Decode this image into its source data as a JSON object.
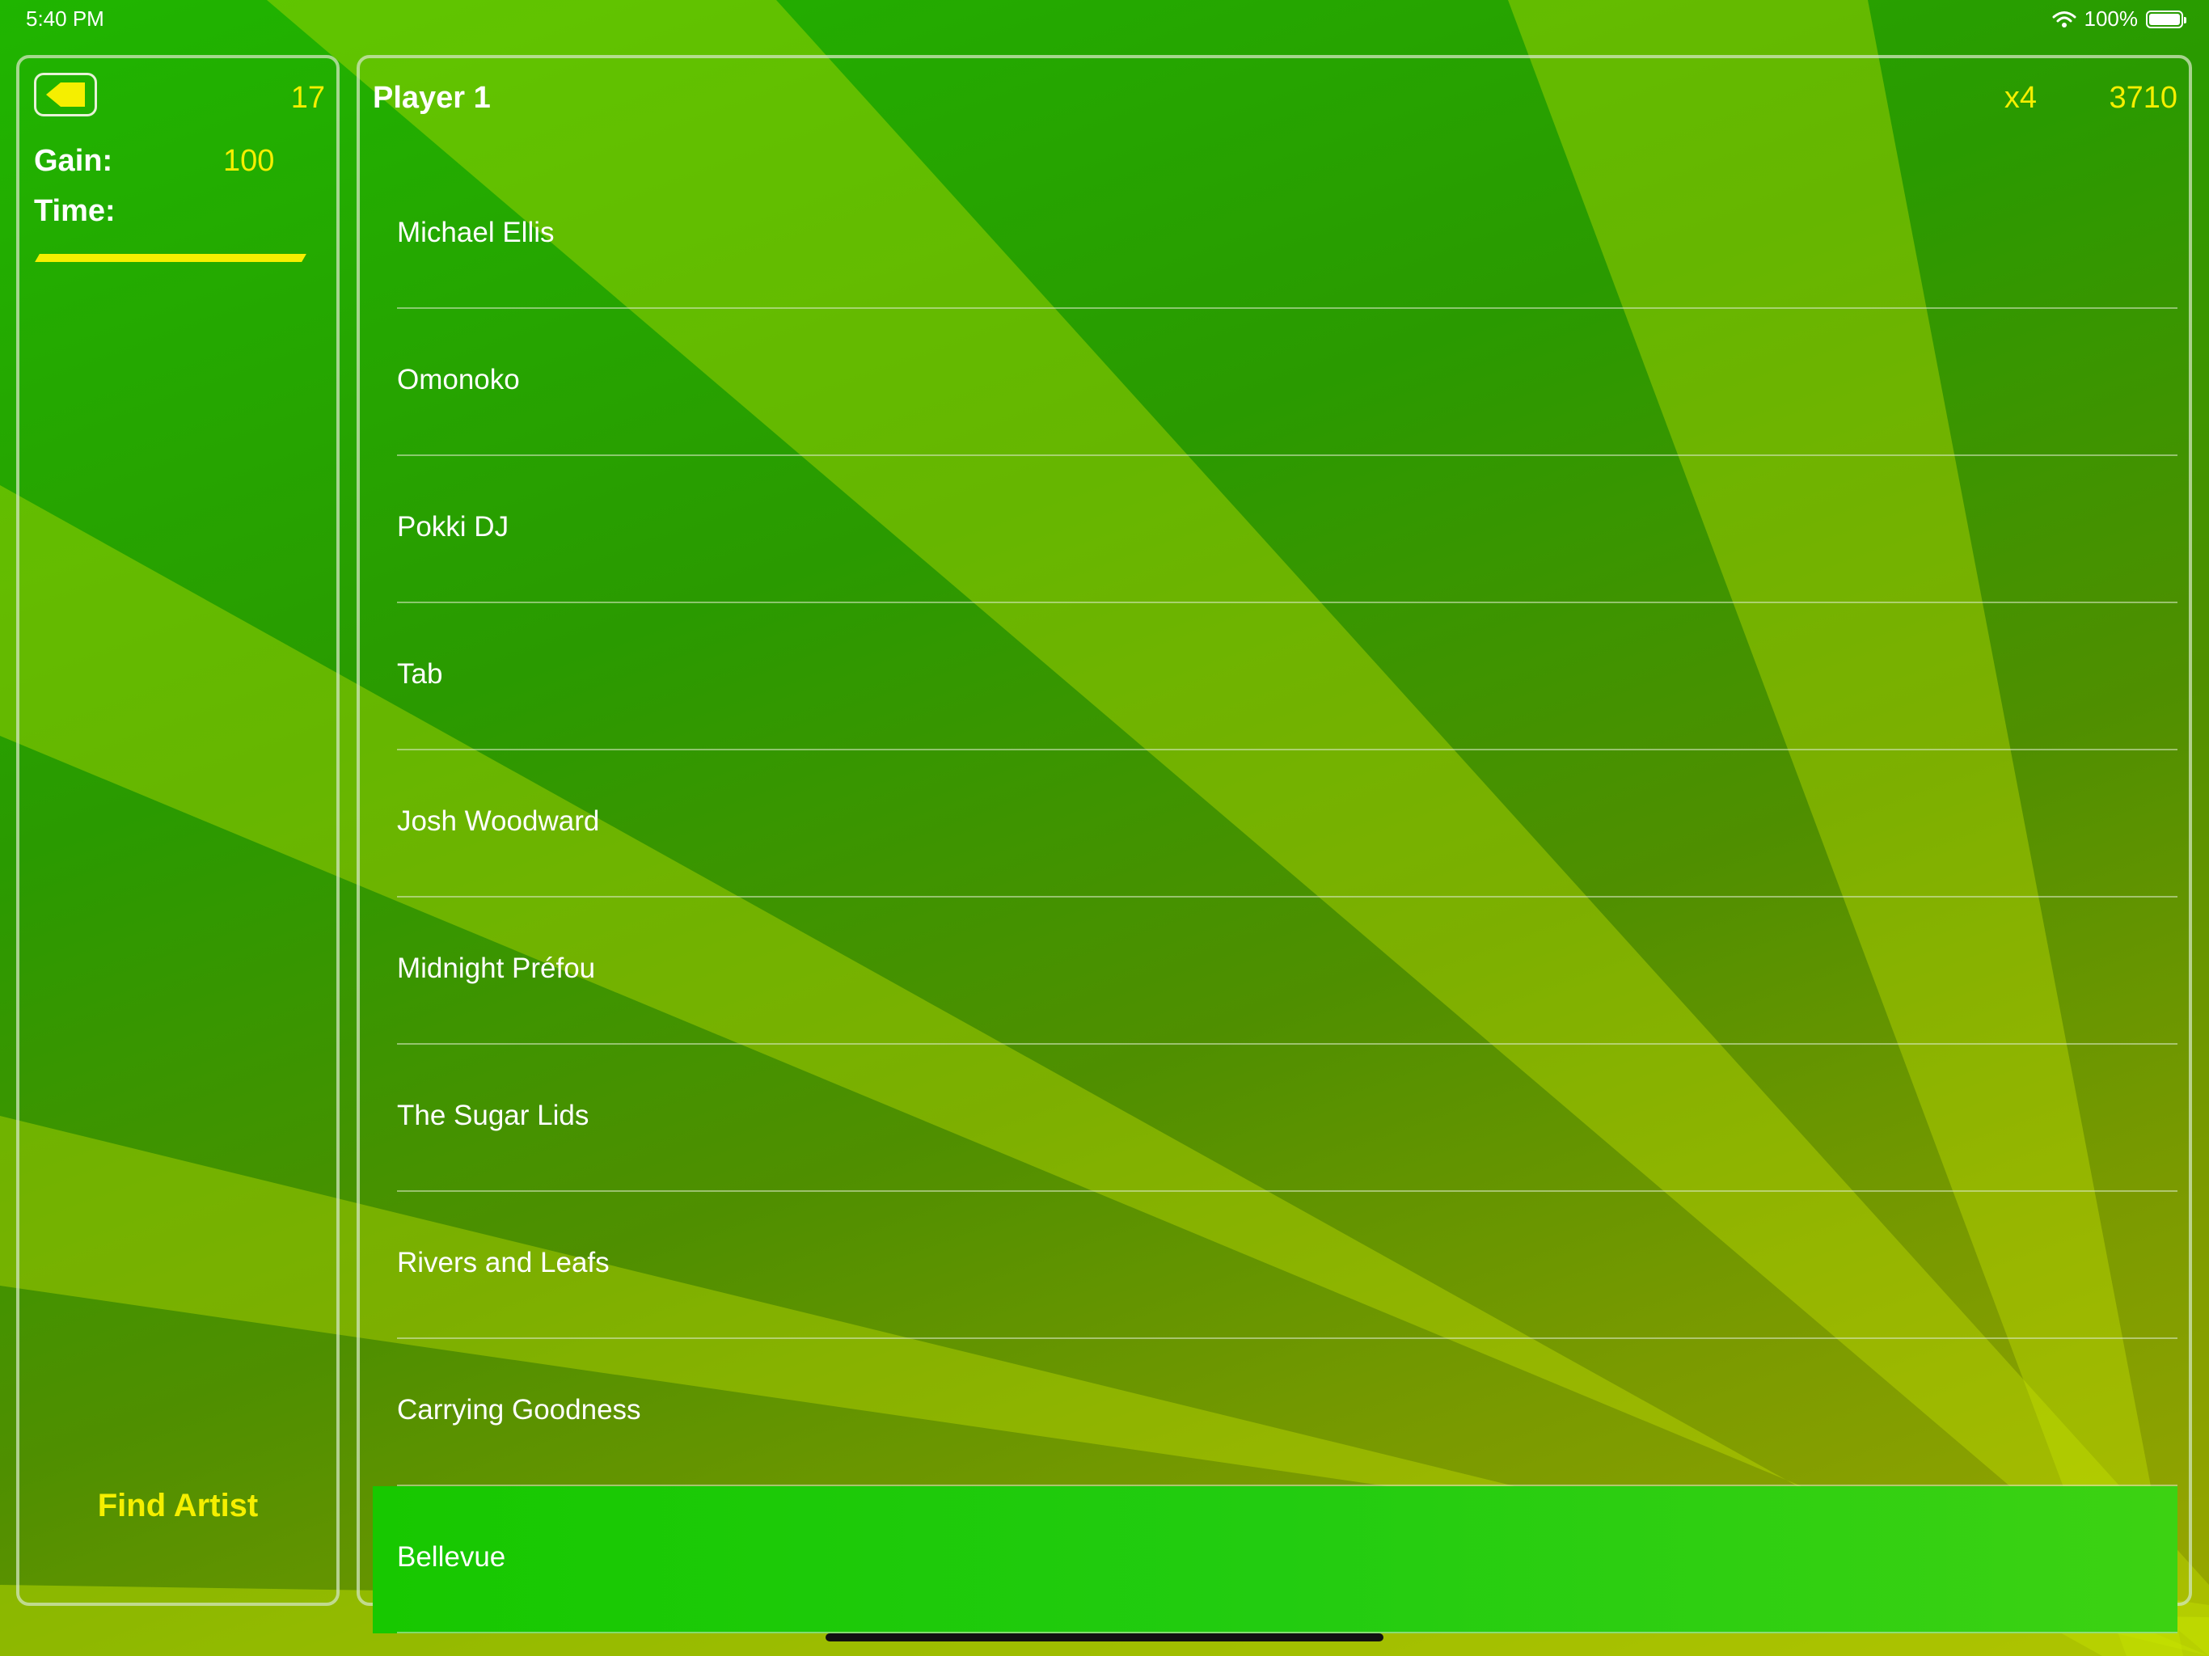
{
  "status_bar": {
    "time": "5:40 PM",
    "battery_percent": "100%"
  },
  "sidebar": {
    "back_icon": "back-arrow-icon",
    "level_count": "17",
    "gain_label": "Gain:",
    "gain_value": "100",
    "time_label": "Time:",
    "time_remaining_fraction": 1.0,
    "find_button_label": "Find Artist"
  },
  "main": {
    "player_name": "Player 1",
    "multiplier": "x4",
    "score": "3710",
    "artists": [
      {
        "name": "Michael Ellis"
      },
      {
        "name": "Omonoko"
      },
      {
        "name": "Pokki DJ"
      },
      {
        "name": "Tab"
      },
      {
        "name": "Josh Woodward"
      },
      {
        "name": "Midnight Préfou"
      },
      {
        "name": "The Sugar Lids"
      },
      {
        "name": "Rivers and Leafs"
      },
      {
        "name": "Carrying Goodness"
      },
      {
        "name": "Bellevue"
      }
    ],
    "selected_index": 9
  },
  "colors": {
    "accent": "#f5ef00",
    "selected_row": "#22cc10",
    "text": "#ffffff"
  }
}
